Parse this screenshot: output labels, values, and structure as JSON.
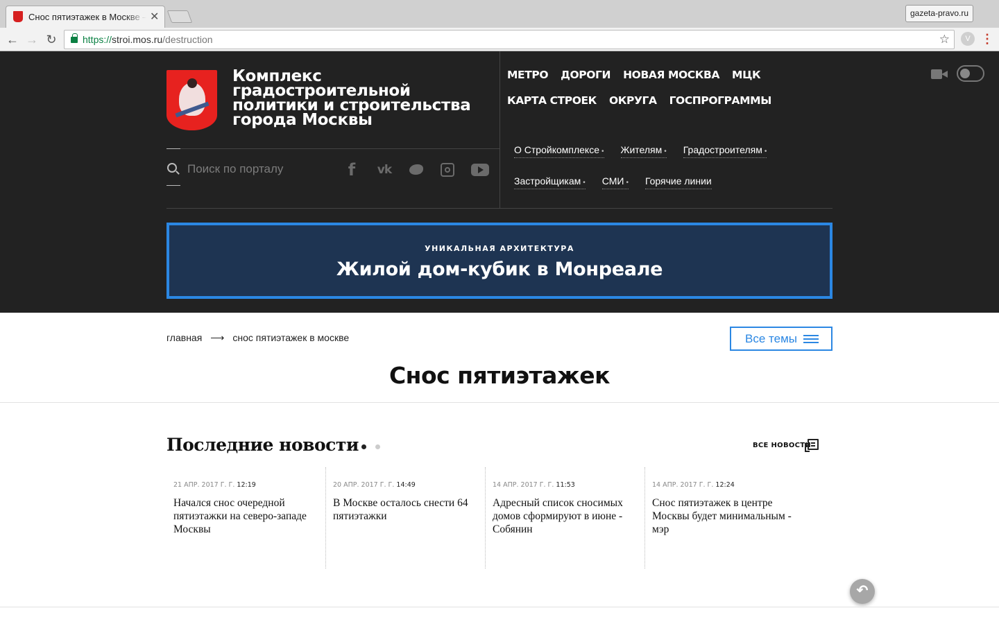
{
  "browser": {
    "tab_title": "Снос пятиэтажек в Москве —",
    "tab_close": "✕",
    "profile": "gazeta-pravo.ru",
    "url_scheme": "https://",
    "url_host": "stroi.mos.ru",
    "url_path": "/destruction",
    "back": "←",
    "forward": "→",
    "reload": "↻",
    "star": "☆",
    "menu": "⋮",
    "ext": "V"
  },
  "site": {
    "title": "Комплекс градостроительной политики и строительства города Москвы",
    "topnav": [
      "МЕТРО",
      "ДОРОГИ",
      "НОВАЯ МОСКВА",
      "МЦК",
      "КАРТА СТРОЕК",
      "ОКРУГА",
      "ГОСПРОГРАММЫ"
    ],
    "search_placeholder": "Поиск по порталу",
    "social": {
      "fb": "f",
      "vk": "vk"
    },
    "subnav_row1": [
      {
        "label": "О Стройкомплексе",
        "caret": "•"
      },
      {
        "label": "Жителям",
        "caret": "•"
      },
      {
        "label": "Градостроителям",
        "caret": "•"
      }
    ],
    "subnav_row2": [
      {
        "label": "Застройщикам",
        "caret": "•"
      },
      {
        "label": "СМИ",
        "caret": "•"
      },
      {
        "label": "Горячие линии",
        "caret": ""
      }
    ]
  },
  "promo": {
    "kicker": "УНИКАЛЬНАЯ АРХИТЕКТУРА",
    "title": "Жилой дом-кубик в Монреале"
  },
  "breadcrumb": {
    "home": "главная",
    "arrow": "⟶",
    "current": "снос пятиэтажек в москве"
  },
  "all_topics": "Все темы",
  "page_title": "Снос пятиэтажек",
  "news": {
    "heading": "Последние новости",
    "all_news": "ВСЕ НОВОСТИ",
    "items": [
      {
        "date": "21 АПР. 2017 Г. Г.",
        "time": "12:19",
        "title": "Начался снос очередной пятиэтажки на северо-западе Москвы"
      },
      {
        "date": "20 АПР. 2017 Г. Г.",
        "time": "14:49",
        "title": "В Москве осталось снести 64 пятиэтажки"
      },
      {
        "date": "14 АПР. 2017 Г. Г.",
        "time": "11:53",
        "title": "Адресный список сносимых домов сформируют в июне - Собянин"
      },
      {
        "date": "14 АПР. 2017 Г. Г.",
        "time": "12:24",
        "title": "Снос пятиэтажек в центре Москвы будет минимальным - мэр"
      }
    ]
  },
  "back_button": "↶"
}
